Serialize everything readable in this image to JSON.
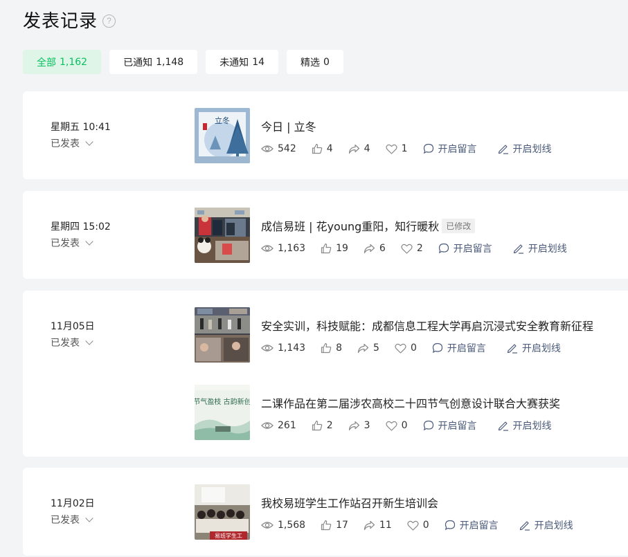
{
  "page": {
    "title": "发表记录",
    "help": "?"
  },
  "filters": [
    {
      "label": "全部",
      "count": "1,162"
    },
    {
      "label": "已通知",
      "count": "1,148"
    },
    {
      "label": "未通知",
      "count": "14"
    },
    {
      "label": "精选",
      "count": "0"
    }
  ],
  "groups": [
    {
      "date": "星期五 10:41",
      "status": "已发表",
      "articles": [
        {
          "title": "今日 | 立冬",
          "edited": "",
          "views": "542",
          "likes": "4",
          "shares": "4",
          "favs": "1",
          "comment_label": "开启留言",
          "underline_label": "开启划线",
          "thumb_text": "立冬"
        }
      ]
    },
    {
      "date": "星期四 15:02",
      "status": "已发表",
      "articles": [
        {
          "title": "成信易班 | 花young重阳，知行暖秋",
          "edited": "已修改",
          "views": "1,163",
          "likes": "19",
          "shares": "6",
          "favs": "2",
          "comment_label": "开启留言",
          "underline_label": "开启划线"
        }
      ]
    },
    {
      "date": "11月05日",
      "status": "已发表",
      "articles": [
        {
          "title": "安全实训，科技赋能：成都信息工程大学再启沉浸式安全教育新征程",
          "edited": "",
          "views": "1,143",
          "likes": "8",
          "shares": "5",
          "favs": "0",
          "comment_label": "开启留言",
          "underline_label": "开启划线"
        },
        {
          "title": "二课作品在第二届涉农高校二十四节气创意设计联合大赛获奖",
          "edited": "",
          "views": "261",
          "likes": "2",
          "shares": "3",
          "favs": "0",
          "comment_label": "开启留言",
          "underline_label": "开启划线",
          "thumb_text": "节气盈枝 古韵新创"
        }
      ]
    },
    {
      "date": "11月02日",
      "status": "已发表",
      "articles": [
        {
          "title": "我校易班学生工作站召开新生培训会",
          "edited": "",
          "views": "1,568",
          "likes": "17",
          "shares": "11",
          "favs": "0",
          "comment_label": "开启留言",
          "underline_label": "开启划线",
          "thumb_text": "易班学生工"
        }
      ]
    }
  ],
  "colors": {
    "accent": "#07c160",
    "accent_bg": "#dff5e7",
    "action": "#4a5a7a",
    "page_bg": "#f3f4f6"
  }
}
